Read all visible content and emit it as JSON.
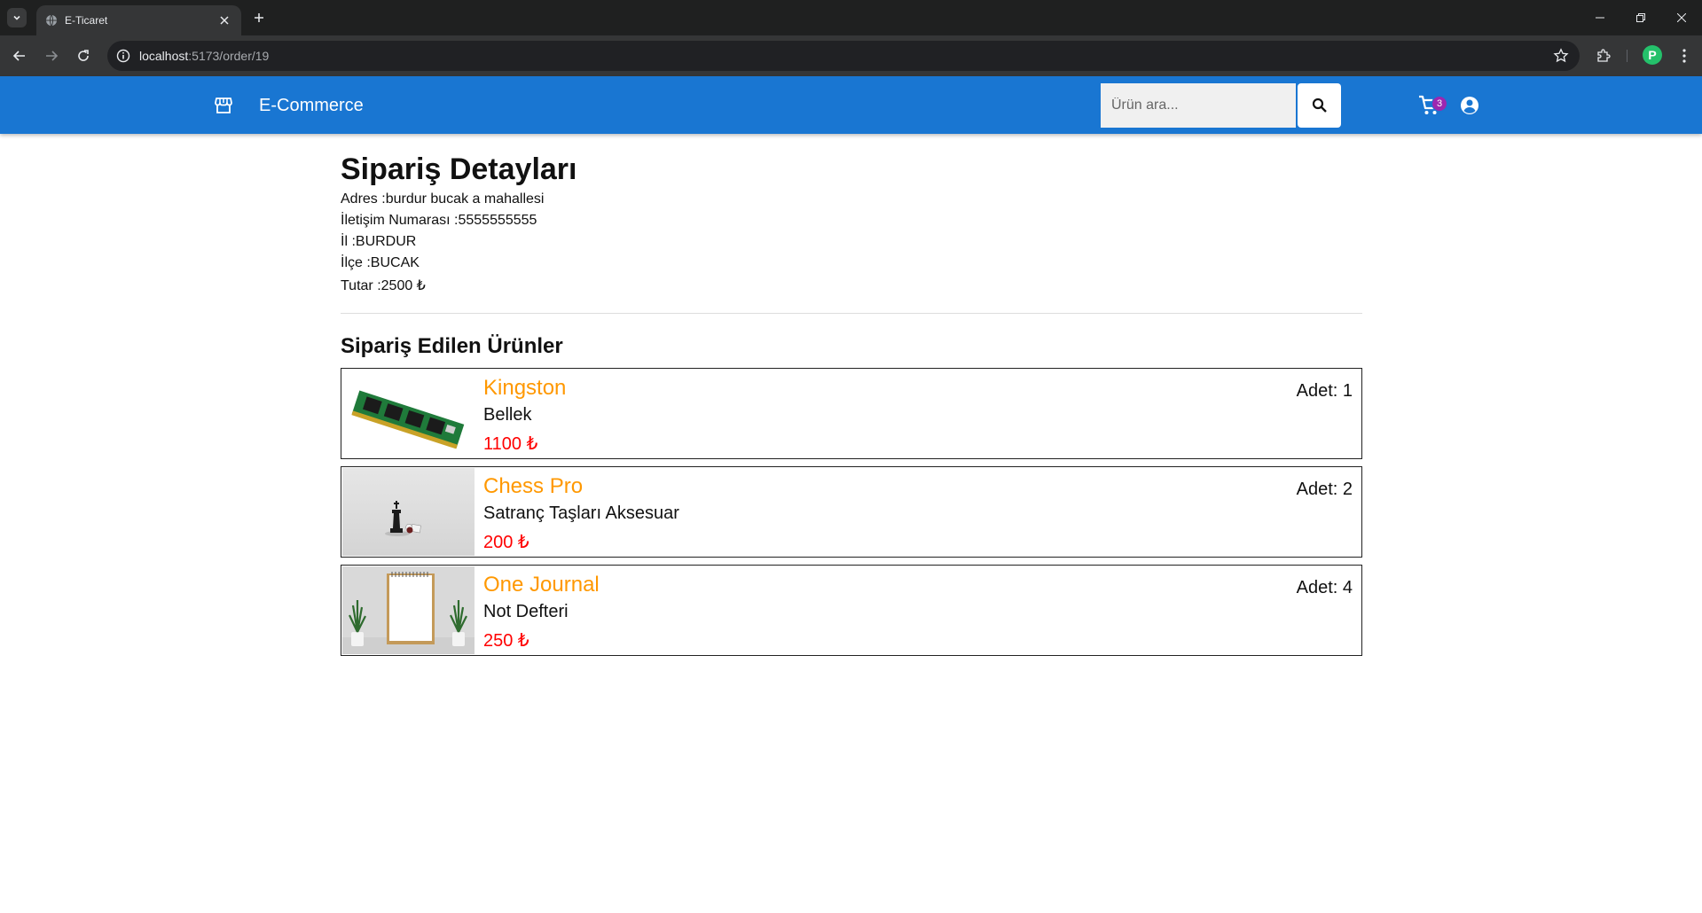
{
  "browser": {
    "tab_title": "E-Ticaret",
    "url_host": "localhost",
    "url_path": ":5173/order/19",
    "profile_initial": "P"
  },
  "navbar": {
    "brand": "E-Commerce",
    "search_placeholder": "Ürün ara...",
    "cart_count": "3",
    "accent_color": "#1976d2"
  },
  "order": {
    "title": "Sipariş Detayları",
    "address": "Adres :burdur bucak a mahallesi",
    "phone": "İletişim Numarası :5555555555",
    "city": "İl :BURDUR",
    "district": "İlçe :BUCAK",
    "total": "Tutar :2500 ₺"
  },
  "items_section": {
    "title": "Sipariş Edilen Ürünler",
    "items": [
      {
        "brand": "Kingston",
        "name": "Bellek",
        "price": "1100 ₺",
        "qty": "Adet: 1",
        "image": "ram-module"
      },
      {
        "brand": "Chess Pro",
        "name": "Satranç Taşları Aksesuar",
        "price": "200 ₺",
        "qty": "Adet: 2",
        "image": "chess-pieces"
      },
      {
        "brand": "One Journal",
        "name": "Not Defteri",
        "price": "250 ₺",
        "qty": "Adet: 4",
        "image": "notebook"
      }
    ]
  }
}
